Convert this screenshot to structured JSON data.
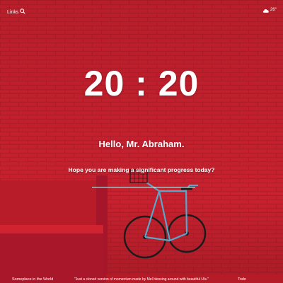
{
  "topbar": {
    "links_label": "Links",
    "search_icon": "search-icon"
  },
  "weather": {
    "icon": "cloud-icon",
    "temperature": "26°"
  },
  "clock": {
    "time": "20 : 20"
  },
  "greeting": {
    "text": "Hello, Mr. Abraham."
  },
  "focus": {
    "question": "Hope you are making a significant progress today?",
    "value": "",
    "placeholder": ""
  },
  "footer": {
    "left_label": "Someplace in the World",
    "quote": "\"Just a cloned version of momentum made by Mel blessing around with beautiful UIs.\"",
    "right_label": "Todo"
  },
  "colors": {
    "wall": "#c8202e",
    "wall_dark": "#9e1822",
    "bench": "#c21f2b",
    "bike_frame": "#5aa6c8"
  }
}
